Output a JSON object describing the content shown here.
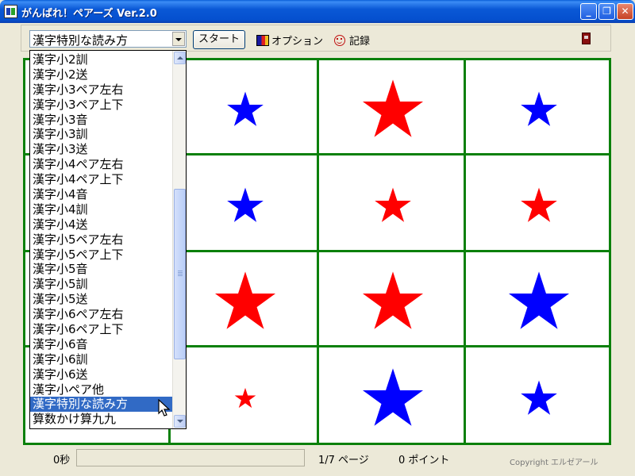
{
  "window": {
    "title": "がんばれ！ペアーズ Ver.2.0",
    "controls": [
      "minimize-icon",
      "restore-icon",
      "close-icon"
    ]
  },
  "toolbar": {
    "category_selected": "漢字特別な読み方",
    "start_label": "スタート",
    "options_label": "オプション",
    "records_label": "記録",
    "icons": {
      "options": "palette-icon",
      "records": "smile-icon",
      "exit": "door-icon"
    }
  },
  "dropdown": {
    "items": [
      "漢字小2訓",
      "漢字小2送",
      "漢字小3ペア左右",
      "漢字小3ペア上下",
      "漢字小3音",
      "漢字小3訓",
      "漢字小3送",
      "漢字小4ペア左右",
      "漢字小4ペア上下",
      "漢字小4音",
      "漢字小4訓",
      "漢字小4送",
      "漢字小5ペア左右",
      "漢字小5ペア上下",
      "漢字小5音",
      "漢字小5訓",
      "漢字小5送",
      "漢字小6ペア左右",
      "漢字小6ペア上下",
      "漢字小6音",
      "漢字小6訓",
      "漢字小6送",
      "漢字小ペア他",
      "漢字特別な読み方",
      "算数かけ算九九"
    ],
    "selected_index": 23
  },
  "board": {
    "colors": {
      "red": "#ff0000",
      "blue": "#0000ff",
      "grid": "#0b800b"
    },
    "cards": [
      [
        {
          "color": "blue",
          "size": "small"
        },
        {
          "color": "red",
          "size": "large"
        },
        {
          "color": "blue",
          "size": "small"
        }
      ],
      [
        {
          "color": "blue",
          "size": "small"
        },
        {
          "color": "red",
          "size": "small"
        },
        {
          "color": "red",
          "size": "small"
        }
      ],
      [
        {
          "color": "red",
          "size": "large"
        },
        {
          "color": "red",
          "size": "large"
        },
        {
          "color": "blue",
          "size": "large"
        }
      ],
      [
        {
          "color": "red",
          "size": "tiny"
        },
        {
          "color": "blue",
          "size": "large"
        },
        {
          "color": "blue",
          "size": "small"
        }
      ]
    ]
  },
  "status": {
    "time": "0秒",
    "progress": 0,
    "page": "1/7 ページ",
    "points": "0 ポイント",
    "copyright": "Copyright エルゼアール"
  }
}
